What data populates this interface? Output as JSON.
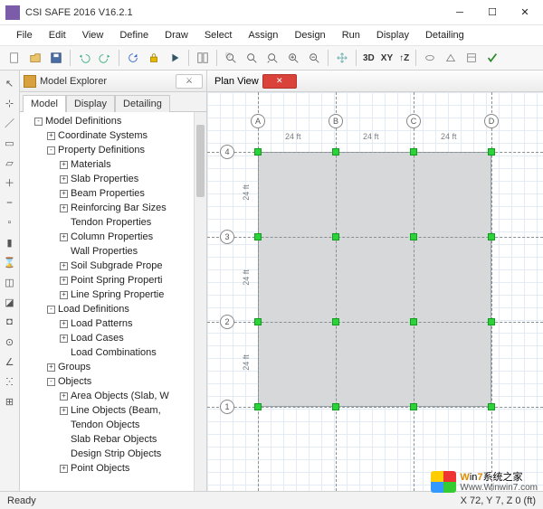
{
  "window": {
    "title": "CSI SAFE 2016 V16.2.1"
  },
  "menus": [
    "File",
    "Edit",
    "View",
    "Define",
    "Draw",
    "Select",
    "Assign",
    "Design",
    "Run",
    "Display",
    "Detailing"
  ],
  "toolbar_text": {
    "threeD": "3D",
    "xy": "XY",
    "tz": "↑Z"
  },
  "explorer": {
    "title": "Model Explorer",
    "close_glyph": "⚔",
    "tabs": [
      "Model",
      "Display",
      "Detailing"
    ],
    "tree": [
      {
        "lvl": 0,
        "exp": "-",
        "label": "Model Definitions"
      },
      {
        "lvl": 1,
        "exp": "+",
        "label": "Coordinate Systems"
      },
      {
        "lvl": 1,
        "exp": "-",
        "label": "Property Definitions"
      },
      {
        "lvl": 2,
        "exp": "+",
        "label": "Materials"
      },
      {
        "lvl": 2,
        "exp": "+",
        "label": "Slab Properties"
      },
      {
        "lvl": 2,
        "exp": "+",
        "label": "Beam Properties"
      },
      {
        "lvl": 2,
        "exp": "+",
        "label": "Reinforcing Bar Sizes"
      },
      {
        "lvl": 2,
        "exp": " ",
        "label": "Tendon Properties"
      },
      {
        "lvl": 2,
        "exp": "+",
        "label": "Column Properties"
      },
      {
        "lvl": 2,
        "exp": " ",
        "label": "Wall Properties"
      },
      {
        "lvl": 2,
        "exp": "+",
        "label": "Soil Subgrade Prope"
      },
      {
        "lvl": 2,
        "exp": "+",
        "label": "Point Spring Properti"
      },
      {
        "lvl": 2,
        "exp": "+",
        "label": "Line Spring Propertie"
      },
      {
        "lvl": 1,
        "exp": "-",
        "label": "Load Definitions"
      },
      {
        "lvl": 2,
        "exp": "+",
        "label": "Load Patterns"
      },
      {
        "lvl": 2,
        "exp": "+",
        "label": "Load Cases"
      },
      {
        "lvl": 2,
        "exp": " ",
        "label": "Load Combinations"
      },
      {
        "lvl": 1,
        "exp": "+",
        "label": "Groups"
      },
      {
        "lvl": 1,
        "exp": "-",
        "label": "Objects"
      },
      {
        "lvl": 2,
        "exp": "+",
        "label": "Area Objects (Slab, W"
      },
      {
        "lvl": 2,
        "exp": "+",
        "label": "Line Objects (Beam,"
      },
      {
        "lvl": 2,
        "exp": " ",
        "label": "Tendon Objects"
      },
      {
        "lvl": 2,
        "exp": " ",
        "label": "Slab Rebar Objects"
      },
      {
        "lvl": 2,
        "exp": " ",
        "label": "Design Strip Objects"
      },
      {
        "lvl": 2,
        "exp": "+",
        "label": "Point Objects"
      }
    ]
  },
  "plan": {
    "title": "Plan View",
    "grid_cols": [
      "A",
      "B",
      "C",
      "D"
    ],
    "grid_rows": [
      "4",
      "3",
      "2",
      "1"
    ],
    "dims": [
      "24 ft",
      "24 ft",
      "24 ft",
      "24 ft",
      "24 ft",
      "24 ft"
    ]
  },
  "status": {
    "left": "Ready",
    "right": "X 72,  Y 7,  Z 0  (ft)"
  },
  "watermark": {
    "brand_a": "W",
    "brand_b": "in",
    "brand_c": "7",
    "brand_tail": "系统之家",
    "url": "Www.Winwin7.com"
  }
}
